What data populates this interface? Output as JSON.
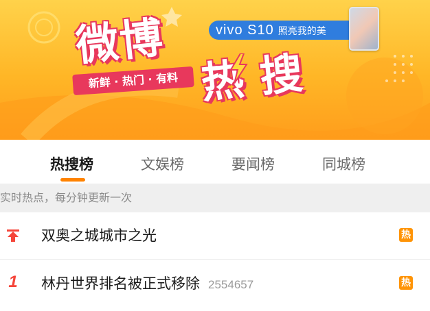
{
  "banner": {
    "title_line1": "微博",
    "title_line2": "热搜",
    "slogan": "新鲜 · 热门 · 有料",
    "ad_brand": "vivo S10",
    "ad_slogan": "照亮我的美",
    "phone_icon": "phone-icon",
    "bolt_icon": "lightning-icon"
  },
  "tabs": [
    {
      "label": "热搜榜",
      "active": true
    },
    {
      "label": "文娱榜",
      "active": false
    },
    {
      "label": "要闻榜",
      "active": false
    },
    {
      "label": "同城榜",
      "active": false
    }
  ],
  "info_text": "实时热点，每分钟更新一次",
  "list": [
    {
      "rank_icon": "pin-top-icon",
      "rank": "",
      "title": "双奥之城城市之光",
      "count": "",
      "badge": "热"
    },
    {
      "rank_icon": "",
      "rank": "1",
      "title": "林丹世界排名被正式移除",
      "count": "2554657",
      "badge": "热"
    }
  ],
  "colors": {
    "accent": "#ff8200",
    "rank_red": "#f5453a",
    "badge_orange": "#ff9406",
    "banner_pink": "#e8385c",
    "ad_blue": "#2f7dde"
  }
}
